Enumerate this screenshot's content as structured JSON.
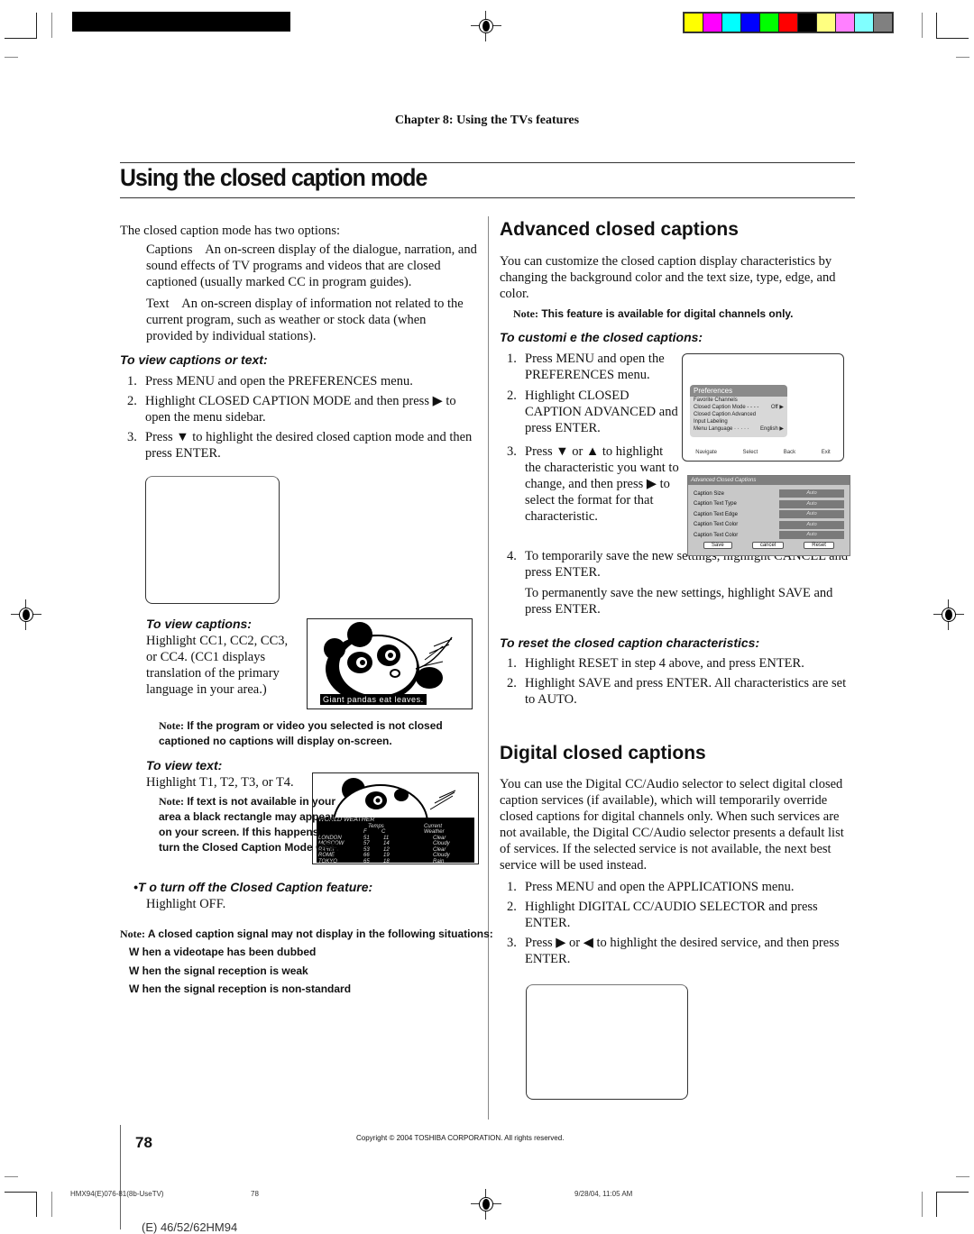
{
  "print_marks": {
    "color_swatches": [
      "#ffff00",
      "#ff00ff",
      "#00ffff",
      "#0000ff",
      "#00ff00",
      "#ff0000",
      "#000000",
      "#ffff80",
      "#ff80ff",
      "#80ffff",
      "#808080"
    ]
  },
  "header": {
    "chapter": "Chapter 8: Using the TVs features",
    "title": "Using the closed caption mode"
  },
  "left": {
    "intro": "The closed caption mode has two options:",
    "options": [
      {
        "term": "Captions",
        "desc": "An on-screen display of the dialogue, narration, and sound effects of TV programs and videos that are closed captioned (usually marked  CC  in program guides)."
      },
      {
        "term": "Text",
        "desc": "An on-screen display of information not related to the current program, such as weather or stock data (when provided by individual stations)."
      }
    ],
    "view_heading": "To view captions or text:",
    "view_steps": [
      {
        "n": "1.",
        "text": "Press MENU and open the PREFERENCES menu."
      },
      {
        "n": "2.",
        "text": "Highlight CLOSED CAPTION MODE and then press ▶ to open the menu sidebar."
      },
      {
        "n": "3.",
        "text": "Press ▼ to highlight the desired closed caption mode and then press ENTER."
      }
    ],
    "view_captions_heading": "To view captions:",
    "view_captions_text": "Highlight CC1, CC2, CC3, or CC4. (CC1 displays translation of the primary language in your area.)",
    "panda_caption": "Giant  pandas  eat  leaves.",
    "note1_label": "Note:",
    "note1_text": "If the program or video you selected is not closed captioned  no captions will display on-screen.",
    "view_text_heading": "To view text:",
    "view_text_text": "Highlight T1, T2, T3, or T4.",
    "note2_label": "Note:",
    "note2_text": "If text is not available in your area  a black rectangle may appear on your screen. If this happens  turn the Closed Caption Mode OFF.",
    "weather": {
      "title": "WORLD WEATHER",
      "col_temps": "Temps",
      "col_f": "F",
      "col_c": "C",
      "col_current": "Current",
      "col_weather": "Weather",
      "rows": [
        {
          "city": "LONDON",
          "f": "51",
          "c": "11",
          "w": "Clear"
        },
        {
          "city": "MOSCOW",
          "f": "57",
          "c": "14",
          "w": "Cloudy"
        },
        {
          "city": "PARIS",
          "f": "53",
          "c": "12",
          "w": "Clear"
        },
        {
          "city": "ROME",
          "f": "66",
          "c": "19",
          "w": "Cloudy"
        },
        {
          "city": "TOKYO",
          "f": "65",
          "c": "18",
          "w": "Rain"
        }
      ]
    },
    "turn_off_heading": "•T o turn off the Closed Caption feature:",
    "turn_off_text": "Highlight OFF.",
    "note3_label": "Note:",
    "note3_text": "A closed caption signal may not display in the following situations:",
    "note3_items": [
      "W hen a videotape has been dubbed",
      "W hen the signal reception is weak",
      "W hen the signal reception is non-standard"
    ]
  },
  "right": {
    "adv_heading": "Advanced closed captions",
    "adv_intro": "You can customize the closed caption display characteristics by changing the background color and the text size, type, edge, and color.",
    "adv_note_label": "Note:",
    "adv_note_text": "This feature is available for digital channels only.",
    "customize_heading": "To customi e the closed captions:",
    "customize_steps": [
      {
        "n": "1.",
        "text": "Press MENU and open the PREFERENCES menu."
      },
      {
        "n": "2.",
        "text": "Highlight CLOSED CAPTION ADVANCED and press ENTER."
      },
      {
        "n": "3.",
        "text": "Press ▼ or ▲ to highlight the characteristic you want to change, and then press ▶ to select the format for that characteristic."
      },
      {
        "n": "4.",
        "text": "To temporarily save the new settings, highlight CANCEL and press ENTER."
      }
    ],
    "permanent_save": "To permanently save the new settings, highlight SAVE and press ENTER.",
    "preferences_menu": {
      "title": "Preferences",
      "items": [
        {
          "label": "Favorite Channels",
          "value": ""
        },
        {
          "label": "Closed Caption Mode - - - -",
          "value": "Off ▶"
        },
        {
          "label": "Closed Caption Advanced",
          "value": ""
        },
        {
          "label": "Input Labeling",
          "value": ""
        },
        {
          "label": "Menu Language · · · · ·",
          "value": "English ▶"
        }
      ],
      "nav": [
        "Navigate",
        "Select",
        "Back",
        "Exit"
      ]
    },
    "advanced_menu": {
      "title": "Advanced Closed Captions",
      "rows": [
        {
          "label": "Caption Size",
          "value": "Auto"
        },
        {
          "label": "Caption Text Type",
          "value": "Auto"
        },
        {
          "label": "Caption Text Edge",
          "value": "Auto"
        },
        {
          "label": "Caption Text Color",
          "value": "Auto"
        },
        {
          "label": "Caption Text Color",
          "value": "Auto"
        }
      ],
      "buttons": [
        "Save",
        "cancel",
        "Reset"
      ]
    },
    "reset_heading": "To reset the closed caption characteristics:",
    "reset_steps": [
      {
        "n": "1.",
        "text": "Highlight RESET in step 4 above, and press ENTER."
      },
      {
        "n": "2.",
        "text": "Highlight SAVE and press ENTER. All characteristics are set to  AUTO."
      }
    ],
    "digital_heading": "Digital closed captions",
    "digital_intro": "You can use the Digital CC/Audio selector to select digital closed caption services (if available), which will temporarily override closed captions for digital channels only. When such services are not available, the Digital CC/Audio selector presents a default list of services. If the selected service is not available, the next best service will be used instead.",
    "digital_steps": [
      {
        "n": "1.",
        "text": "Press MENU and open the APPLICATIONS menu."
      },
      {
        "n": "2.",
        "text": "Highlight DIGITAL CC/AUDIO SELECTOR and press ENTER."
      },
      {
        "n": "3.",
        "text": "Press ▶ or ◀ to highlight the desired service, and then press ENTER."
      }
    ]
  },
  "footer": {
    "page_number": "78",
    "copyright": "Copyright © 2004 TOSHIBA CORPORATION. All rights reserved.",
    "slug_file": "HMX94(E)076-81(8b-UseTV)",
    "slug_page": "78",
    "slug_date": "9/28/04, 11:05 AM",
    "model": "(E) 46/52/62HM94"
  }
}
